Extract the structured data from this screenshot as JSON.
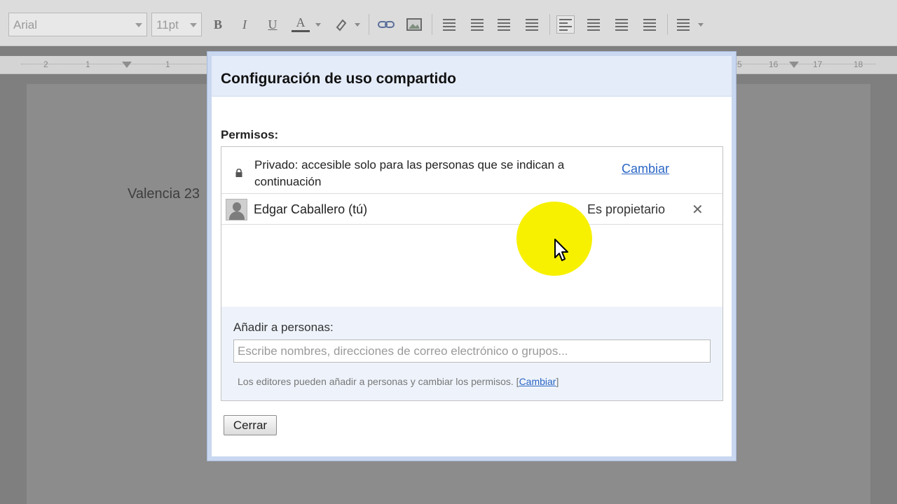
{
  "toolbar": {
    "font_family": "Arial",
    "font_size": "11pt",
    "bold_label": "B",
    "italic_label": "I",
    "underline_label": "U",
    "text_color_label": "A"
  },
  "ruler": {
    "numbers": [
      "2",
      "1",
      "1",
      "5",
      "16",
      "17",
      "18"
    ]
  },
  "document": {
    "visible_text": "Valencia 23"
  },
  "dialog": {
    "title": "Configuración de uso compartido",
    "permissions_label": "Permisos:",
    "private_text": "Privado: accesible solo para las personas que se indican a continuación",
    "private_change_link": "Cambiar",
    "owner_name": "Edgar Caballero (tú)",
    "owner_role": "Es propietario",
    "remove_symbol": "✕",
    "add_label": "Añadir a personas:",
    "add_placeholder": "Escribe nombres, direcciones de correo electrónico o grupos...",
    "add_value": "",
    "note_text": "Los editores pueden añadir a personas y cambiar los permisos.",
    "note_bracket_open": "[",
    "note_change_link": "Cambiar",
    "note_bracket_close": "]",
    "close_button": "Cerrar"
  },
  "colors": {
    "dialog_frame": "#c9d7f0",
    "header_bg": "#e5ecf9",
    "link": "#2a66c4",
    "cursor_highlight": "#f7f100"
  }
}
